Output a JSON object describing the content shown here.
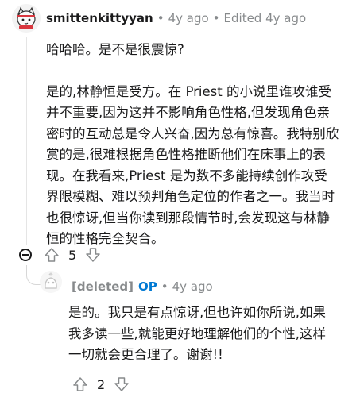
{
  "comment": {
    "username": "smittenkittyyan",
    "time": "4y ago",
    "edited": "Edited 4y ago",
    "paragraphs": [
      "哈哈哈。是不是很震惊?",
      "是的,林静恒是受方。在 Priest 的小说里谁攻谁受并不重要,因为这并不影响角色性格,但发现角色亲密时的互动总是令人兴奋,因为总有惊喜。我特别欣赏的是,很难根据角色性格推断他们在床事上的表现。在我看来,Priest 是为数不多能持续创作攻受界限模糊、难以预判角色定位的作者之一。我当时也很惊讶,但当你读到那段情节时,会发现这与林静恒的性格完全契合。"
    ],
    "score": "5"
  },
  "reply": {
    "username": "[deleted]",
    "op_badge": "OP",
    "time": "4y ago",
    "paragraphs": [
      "是的。我只是有点惊讶,但也许如你所说,如果我多读一些,就能更好地理解他们的个性,这样一切就会更合理了。谢谢!!"
    ],
    "score": "2"
  },
  "icons": {
    "main_avatar": "cat-avatar-icon",
    "reply_avatar": "deleted-user-avatar-icon",
    "collapse": "collapse-thread-icon",
    "upvote": "upvote-arrow-icon",
    "downvote": "downvote-arrow-icon"
  },
  "colors": {
    "text": "#1a1a1b",
    "muted": "#878a8c",
    "op": "#0079d3"
  }
}
